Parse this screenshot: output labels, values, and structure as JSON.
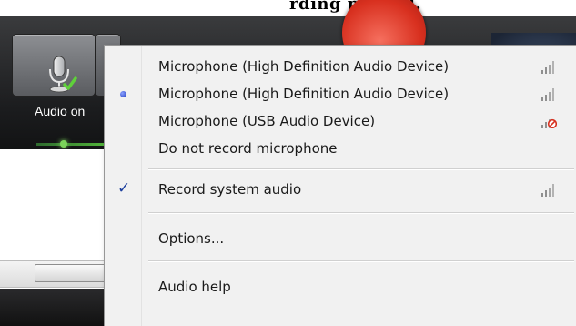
{
  "topbar": {
    "partial_text": "rding paused."
  },
  "recorder": {
    "audio_label": "Audio on"
  },
  "menu": {
    "items": [
      {
        "label": "Microphone (High Definition Audio Device)",
        "selected": false,
        "checked": false,
        "signal": "level-bars-icon"
      },
      {
        "label": "Microphone (High Definition Audio Device)",
        "selected": true,
        "checked": false,
        "signal": "level-bars-icon"
      },
      {
        "label": "Microphone (USB Audio Device)",
        "selected": false,
        "checked": false,
        "signal": "level-bars-disabled-icon"
      },
      {
        "label": "Do not record microphone",
        "selected": false,
        "checked": false
      },
      {
        "label": "Record system audio",
        "selected": false,
        "checked": true,
        "signal": "level-bars-icon"
      },
      {
        "label": "Options...",
        "selected": false,
        "checked": false
      },
      {
        "label": "Audio help",
        "selected": false,
        "checked": false
      }
    ],
    "check_glyph": "✓"
  },
  "colors": {
    "accent": "#1f3bbd",
    "record": "#d8301f",
    "level": "#53b83a"
  }
}
